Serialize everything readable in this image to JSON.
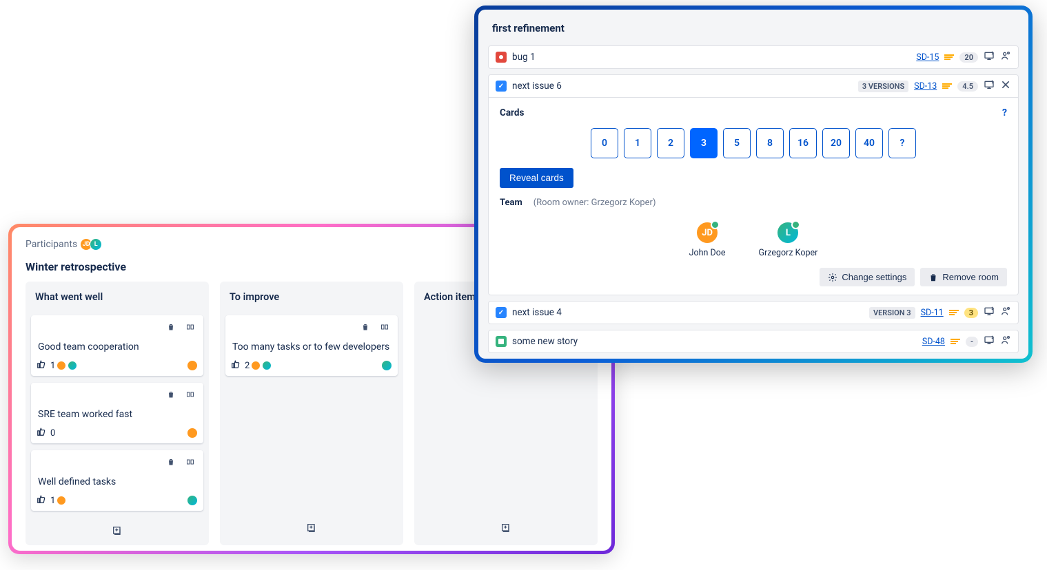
{
  "retro": {
    "participants_label": "Participants",
    "title": "Winter retrospective",
    "columns": [
      {
        "title": "What went well",
        "cards": [
          {
            "text": "Good team cooperation",
            "likes": 1
          },
          {
            "text": "SRE team worked fast",
            "likes": 0
          },
          {
            "text": "Well defined tasks",
            "likes": 1
          }
        ]
      },
      {
        "title": "To improve",
        "cards": [
          {
            "text": "Too many tasks or to few developers",
            "likes": 2
          }
        ]
      },
      {
        "title": "Action items",
        "cards": []
      }
    ]
  },
  "poker": {
    "title": "first refinement",
    "issues": [
      {
        "type": "bug",
        "name": "bug 1",
        "versions_pill": null,
        "key": "SD-15",
        "est": "20",
        "est_color": "grey",
        "tail": "present"
      },
      {
        "type": "task",
        "name": "next issue 6",
        "versions_pill": "3 VERSIONS",
        "key": "SD-13",
        "est": "4.5",
        "est_color": "grey",
        "tail": "close"
      },
      {
        "type": "task",
        "name": "next issue 4",
        "versions_pill": "VERSION 3",
        "key": "SD-11",
        "est": "3",
        "est_color": "yellow",
        "tail": "present"
      },
      {
        "type": "story",
        "name": "some new story",
        "versions_pill": null,
        "key": "SD-48",
        "est": "-",
        "est_color": "grey",
        "tail": "present"
      }
    ],
    "cards_section": "Cards",
    "reveal_label": "Reveal cards",
    "team_label": "Team",
    "room_owner": "(Room owner: Grzegorz Koper)",
    "members": [
      {
        "name": "John Doe",
        "initials": "JD",
        "color": "orange"
      },
      {
        "name": "Grzegorz Koper",
        "initials": "L",
        "color": "teal"
      }
    ],
    "card_values": [
      "0",
      "1",
      "2",
      "3",
      "5",
      "8",
      "16",
      "20",
      "40",
      "?"
    ],
    "selected_card": "3",
    "settings_label": "Change settings",
    "remove_label": "Remove room"
  }
}
